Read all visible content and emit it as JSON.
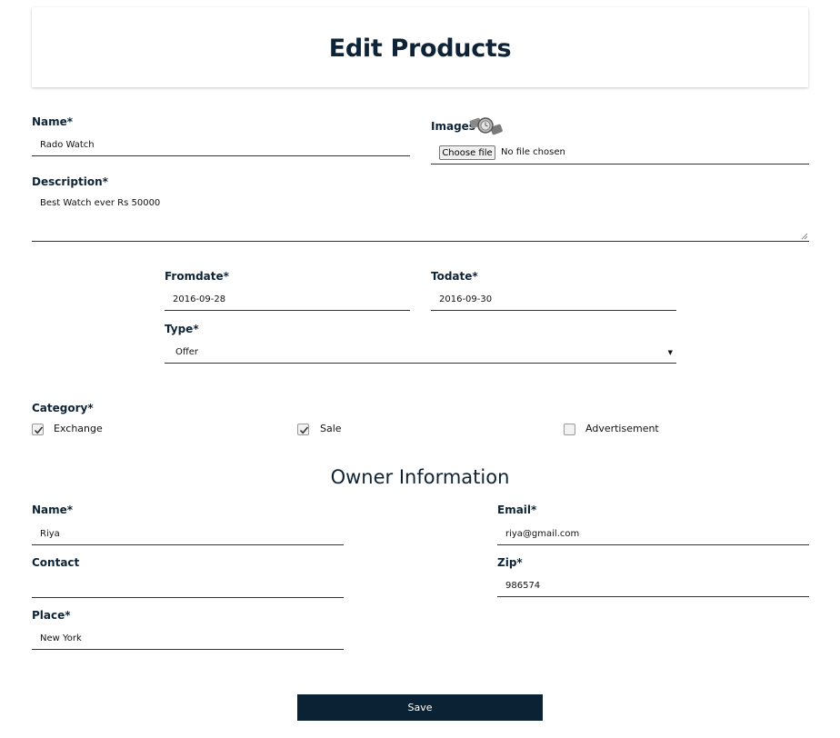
{
  "page": {
    "title": "Edit Products"
  },
  "product": {
    "name_label": "Name*",
    "name_value": "Rado Watch",
    "images_label": "Images",
    "file_button": "Choose file",
    "file_status": "No file chosen",
    "description_label": "Description*",
    "description_value": "Best Watch ever Rs 50000",
    "fromdate_label": "Fromdate*",
    "fromdate_value": "2016-09-28",
    "todate_label": "Todate*",
    "todate_value": "2016-09-30",
    "type_label": "Type*",
    "type_value": "Offer",
    "category_label": "Category*",
    "categories": [
      {
        "label": "Exchange",
        "checked": true
      },
      {
        "label": "Sale",
        "checked": true
      },
      {
        "label": "Advertisement",
        "checked": false
      }
    ]
  },
  "owner": {
    "section_title": "Owner Information",
    "name_label": "Name*",
    "name_value": "Riya",
    "email_label": "Email*",
    "email_value": "riya@gmail.com",
    "contact_label": "Contact",
    "contact_value": "",
    "zip_label": "Zip*",
    "zip_value": "986574",
    "place_label": "Place*",
    "place_value": "New York"
  },
  "actions": {
    "save_label": "Save"
  },
  "icons": {
    "image_thumbnail": "watch-thumbnail-icon",
    "select_caret": "caret-down-icon",
    "check": "checkmark-icon"
  }
}
